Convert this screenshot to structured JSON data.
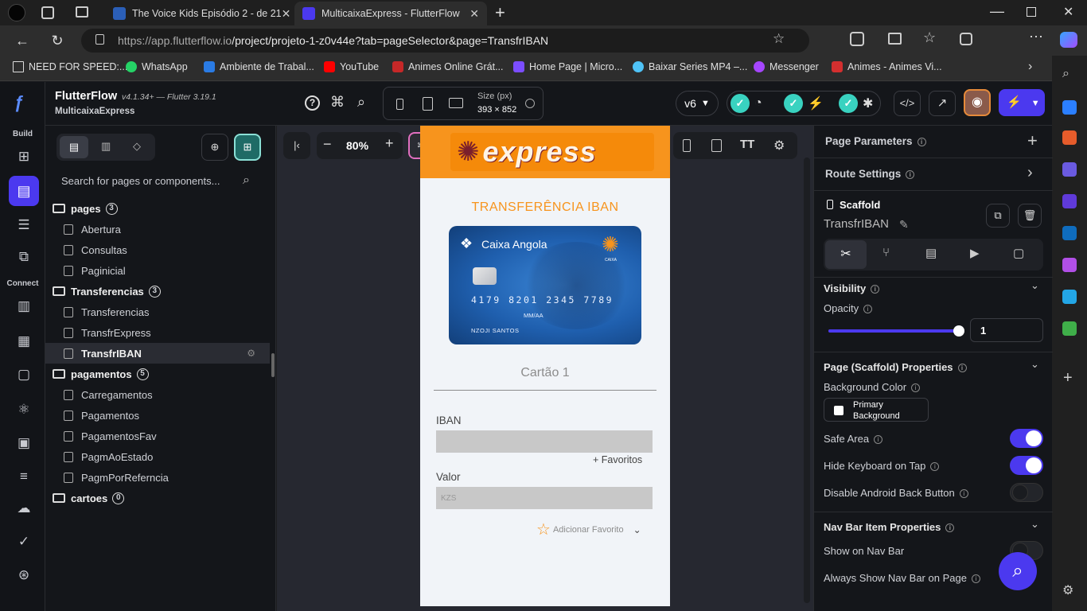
{
  "browser": {
    "tabs": [
      {
        "title": "The Voice Kids Episódio 2 - de 21"
      },
      {
        "title": "MulticaixaExpress - FlutterFlow"
      }
    ],
    "url_host": "https://app.flutterflow.io",
    "url_path": "/project/projeto-1-z0v44e?tab=pageSelector&page=TransfrIBAN",
    "bookmarks": [
      "NEED FOR SPEED:...",
      "WhatsApp",
      "Ambiente de Trabal...",
      "YouTube",
      "Animes Online Grát...",
      "Home Page | Micro...",
      "Baixar Series MP4 –...",
      "Messenger",
      "Animes - Animes Vi..."
    ]
  },
  "app": {
    "name": "FlutterFlow",
    "version": "v4.1.34+ — Flutter 3.19.1",
    "project": "MulticaixaExpress",
    "size_label": "Size (px)",
    "size_value": "393 × 852",
    "version_select": "v6",
    "zoom": "80%"
  },
  "rail": {
    "build": "Build",
    "connect": "Connect"
  },
  "pages_panel": {
    "search_placeholder": "Search for pages or components...",
    "tree": [
      {
        "type": "folder",
        "label": "pages",
        "count": "3"
      },
      {
        "type": "page",
        "label": "Abertura"
      },
      {
        "type": "page",
        "label": "Consultas"
      },
      {
        "type": "page",
        "label": "Paginicial"
      },
      {
        "type": "folder",
        "label": "Transferencias",
        "count": "3"
      },
      {
        "type": "page",
        "label": "Transferencias"
      },
      {
        "type": "page",
        "label": "TransfrExpress"
      },
      {
        "type": "page",
        "label": "TransfrIBAN",
        "selected": true
      },
      {
        "type": "folder",
        "label": "pagamentos",
        "count": "5"
      },
      {
        "type": "page",
        "label": "Carregamentos"
      },
      {
        "type": "page",
        "label": "Pagamentos"
      },
      {
        "type": "page",
        "label": "PagamentosFav"
      },
      {
        "type": "page",
        "label": "PagmAoEstado"
      },
      {
        "type": "page",
        "label": "PagmPorReferncia"
      },
      {
        "type": "folder",
        "label": "cartoes",
        "count": "0"
      }
    ]
  },
  "phone": {
    "header_logo": "express",
    "title": "TRANSFERÊNCIA IBAN",
    "card": {
      "bank": "Caixa Angola",
      "number": "4179 8201 2345 7789",
      "expiry": "MM/AA",
      "holder": "NZOJI SANTOS",
      "brand": "CAIXA"
    },
    "card_label": "Cartão 1",
    "iban_label": "IBAN",
    "favoritos_link": "+ Favoritos",
    "valor_label": "Valor",
    "valor_placeholder": "KZS",
    "add_favorite": "Adicionar Favorito"
  },
  "props": {
    "page_parameters": "Page Parameters",
    "route_settings": "Route Settings",
    "widget_type": "Scaffold",
    "widget_name": "TransfrIBAN",
    "visibility": "Visibility",
    "opacity_label": "Opacity",
    "opacity_value": "1",
    "opacity_level": 1,
    "scaffold_props": "Page (Scaffold) Properties",
    "bg_color_label": "Background Color",
    "bg_color_value": "Primary Background",
    "safe_area": "Safe Area",
    "safe_area_on": true,
    "hide_keyboard": "Hide Keyboard on Tap",
    "hide_keyboard_on": true,
    "disable_back": "Disable Android Back Button",
    "disable_back_on": false,
    "navbar_props": "Nav Bar Item Properties",
    "show_navbar": "Show on Nav Bar",
    "always_show_navbar": "Always Show Nav Bar on Page"
  },
  "colors": {
    "accent": "#4b39ef",
    "orange": "#f7941d",
    "teal": "#39d2c0",
    "title_orange": "#f7941d"
  }
}
